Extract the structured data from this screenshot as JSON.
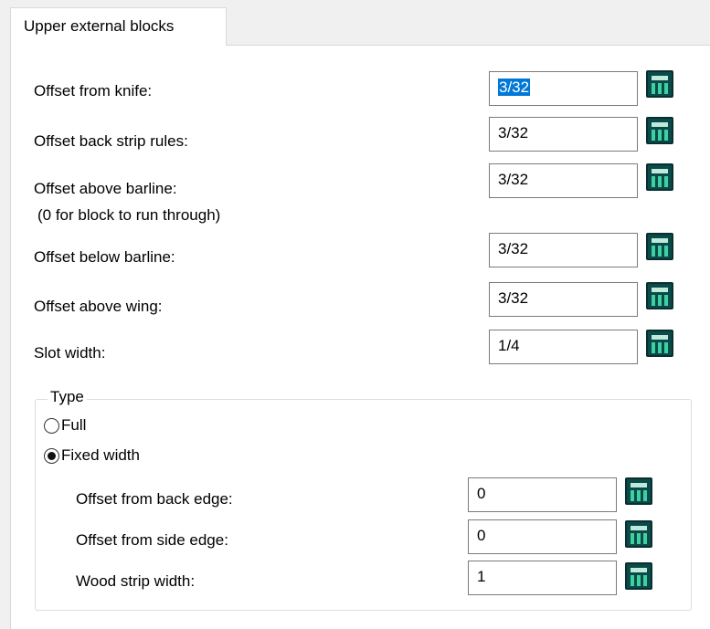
{
  "tab": {
    "label": "Upper external blocks"
  },
  "fields": [
    {
      "label": "Offset from knife:",
      "value": "3/32"
    },
    {
      "label": "Offset back strip rules:",
      "value": "3/32"
    },
    {
      "label": "Offset above barline:",
      "sublabel": "(0 for block to run through)",
      "value": "3/32"
    },
    {
      "label": "Offset below barline:",
      "value": "3/32"
    },
    {
      "label": "Offset above wing:",
      "value": "3/32"
    },
    {
      "label": "Slot width:",
      "value": "1/4"
    }
  ],
  "type_group": {
    "title": "Type",
    "options": [
      {
        "label": "Full",
        "selected": false
      },
      {
        "label": "Fixed width",
        "selected": true
      }
    ],
    "fields": [
      {
        "label": "Offset from back edge:",
        "value": "0"
      },
      {
        "label": "Offset from side edge:",
        "value": "0"
      },
      {
        "label": "Wood strip width:",
        "value": "1"
      }
    ]
  },
  "icons": {
    "calculator": "calculator-icon"
  }
}
